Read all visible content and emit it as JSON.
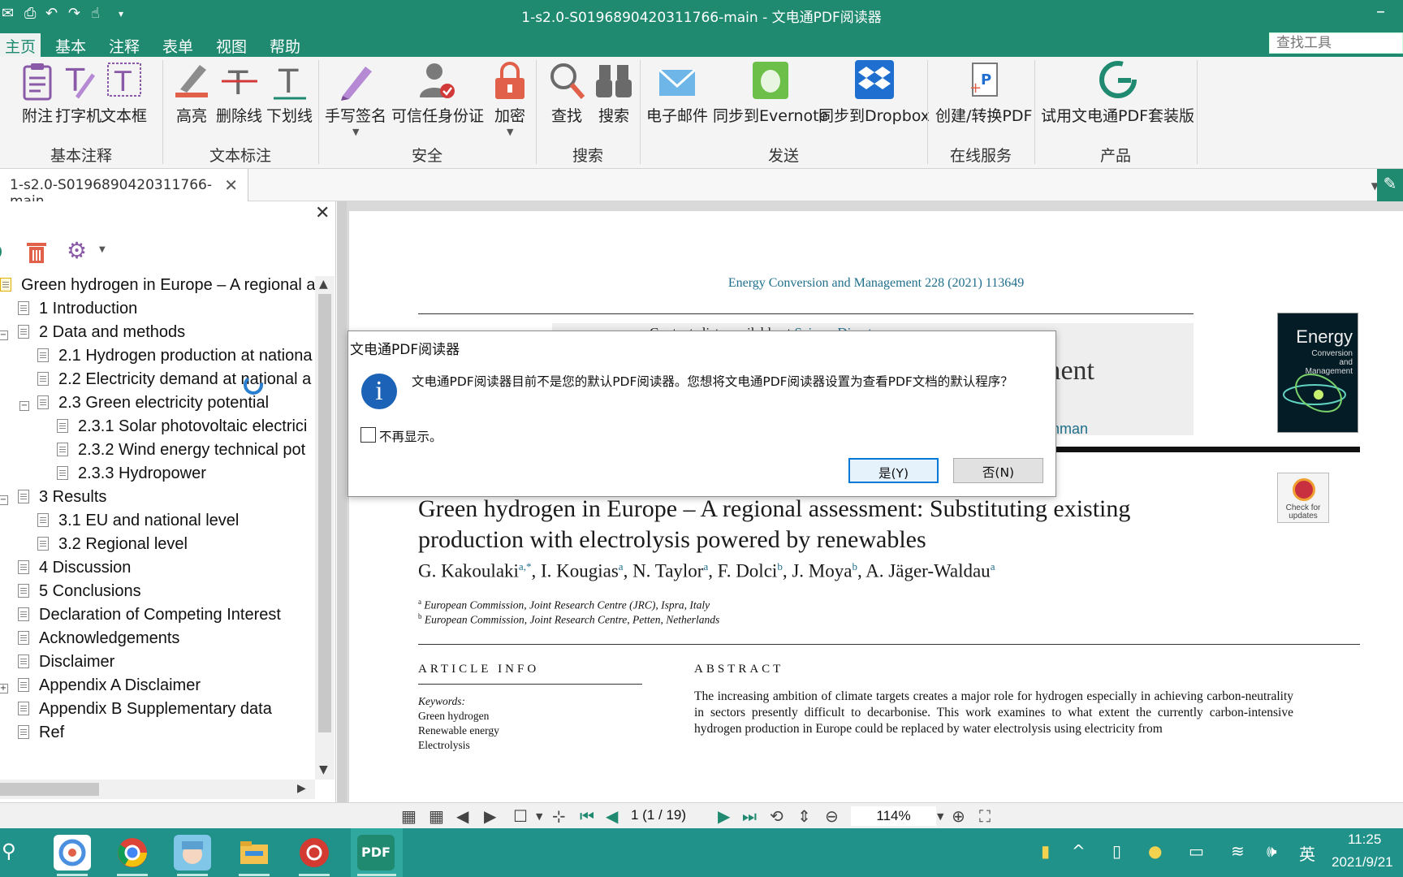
{
  "window": {
    "title": "1-s2.0-S0196890420311766-main - 文电通PDF阅读器"
  },
  "menu": {
    "items": [
      "主页",
      "基本",
      "注释",
      "表单",
      "视图",
      "帮助"
    ],
    "search_placeholder": "查找工具"
  },
  "ribbon": {
    "buttons": {
      "note": "附注",
      "typewriter": "打字机",
      "textbox": "文本框",
      "highlight": "高亮",
      "strikeout": "删除线",
      "underline": "下划线",
      "signature": "手写签名",
      "trusted_id": "可信任身份证",
      "encrypt": "加密",
      "find": "查找",
      "search": "搜索",
      "email": "电子邮件",
      "evernote": "同步到Evernote",
      "dropbox": "同步到Dropbox",
      "create_convert": "创建/转换PDF",
      "trial": "试用文电通PDF套装版"
    },
    "groups": {
      "basic_annot": "基本注释",
      "text_markup": "文本标注",
      "security": "安全",
      "search": "搜索",
      "send": "发送",
      "online": "在线服务",
      "product": "产品"
    }
  },
  "tab": {
    "label": "1-s2.0-S0196890420311766-main"
  },
  "bookmarks": [
    "Green hydrogen in Europe – A regional a",
    "1 Introduction",
    "2 Data and methods",
    "2.1 Hydrogen production at nationa",
    "2.2 Electricity demand at national a",
    "2.3 Green electricity potential",
    "2.3.1 Solar photovoltaic electrici",
    "2.3.2 Wind energy technical pot",
    "2.3.3 Hydropower",
    "3 Results",
    "3.1 EU and national level",
    "3.2 Regional level",
    "4 Discussion",
    "5 Conclusions",
    "Declaration of Competing Interest",
    "Acknowledgements",
    "Disclaimer",
    "Appendix A Disclaimer",
    "Appendix B Supplementary data",
    "Ref"
  ],
  "document": {
    "journal_line": "Energy Conversion and Management 228 (2021) 113649",
    "banner_top": "Contents lists available at ",
    "banner_top_link": "ScienceDirect",
    "banner_title": "ment",
    "banner_link": "onman",
    "cover_title": "Energy",
    "cover_subtitle": "Conversion and Management",
    "check_label": "Check for updates",
    "title": "Green hydrogen in Europe – A regional assessment: Substituting existing production with electrolysis powered by renewables",
    "authors": [
      {
        "name": "G. Kakoulaki",
        "sup": "a,*"
      },
      {
        "name": "I. Kougias",
        "sup": "a"
      },
      {
        "name": "N. Taylor",
        "sup": "a"
      },
      {
        "name": "F. Dolci",
        "sup": "b"
      },
      {
        "name": "J. Moya",
        "sup": "b"
      },
      {
        "name": "A. Jäger-Waldau",
        "sup": "a"
      }
    ],
    "affiliations": [
      {
        "sup": "a",
        "text": "European Commission, Joint Research Centre (JRC), Ispra, Italy"
      },
      {
        "sup": "b",
        "text": "European Commission, Joint Research Centre, Petten, Netherlands"
      }
    ],
    "article_info_heading": "ARTICLE INFO",
    "abstract_heading": "ABSTRACT",
    "keywords_label": "Keywords:",
    "keywords": [
      "Green hydrogen",
      "Renewable energy",
      "Electrolysis"
    ],
    "abstract": "The increasing ambition of climate targets creates a major role for hydrogen especially in achieving carbon-neutrality in sectors presently difficult to decarbonise. This work examines to what extent the currently carbon-intensive hydrogen production in Europe could be replaced by water electrolysis using electricity from"
  },
  "navbar": {
    "page": "1 (1 / 19)",
    "zoom": "114%"
  },
  "dialog": {
    "title": "文电通PDF阅读器",
    "message": "文电通PDF阅读器目前不是您的默认PDF阅读器。您想将文电通PDF阅读器设置为查看PDF文档的默认程序？",
    "dont_show": "不再显示。",
    "yes": "是(Y)",
    "no": "否(N)"
  },
  "taskbar": {
    "time": "11:25",
    "date": "2021/9/21",
    "ime": "英",
    "pdf_label": "PDF"
  },
  "colors": {
    "accent": "#1f8a70",
    "taskbar": "#20928a",
    "link": "#1f6f8b",
    "dialog_icon": "#1c63b8"
  }
}
